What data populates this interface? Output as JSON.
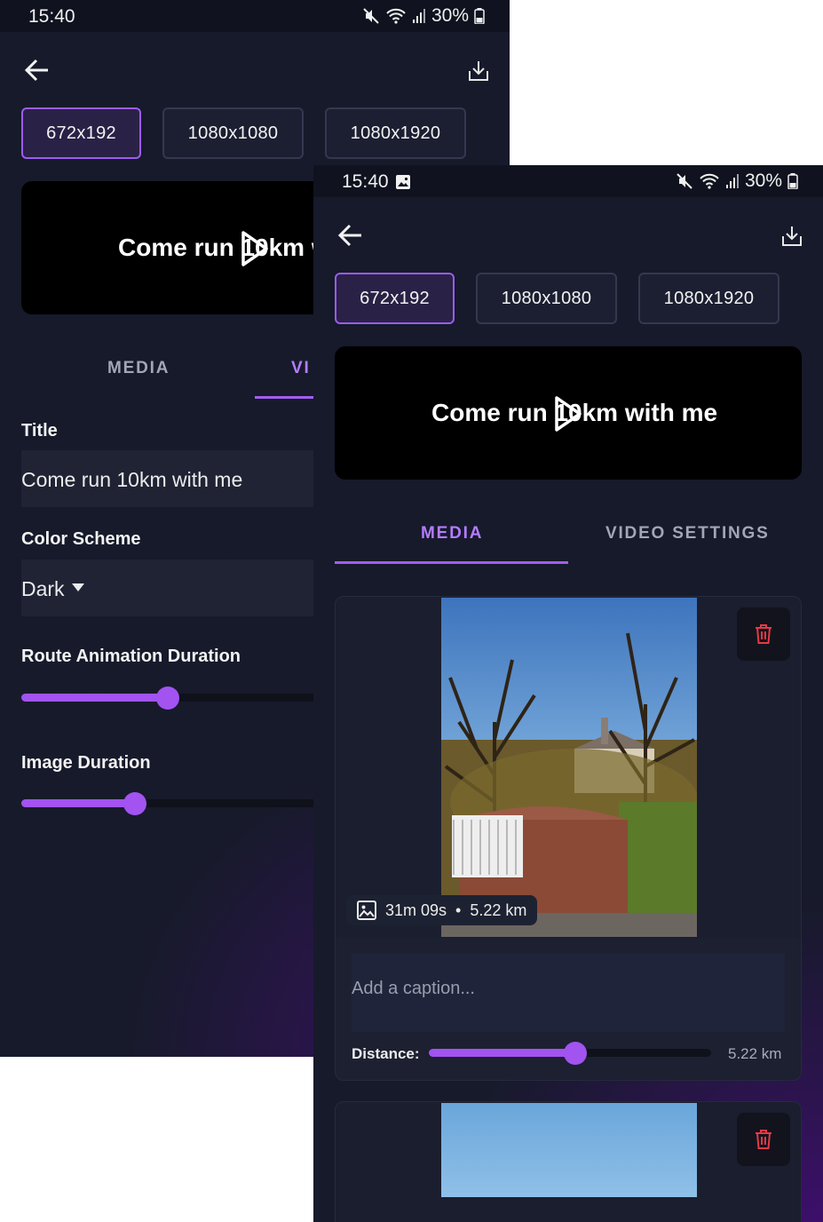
{
  "status_bar": {
    "time": "15:40",
    "battery": "30%"
  },
  "size_options": [
    "672x192",
    "1080x1080",
    "1080x1920"
  ],
  "selected_size": "672x192",
  "preview": {
    "text": "Come run 10km with me"
  },
  "tabs": [
    {
      "label": "MEDIA"
    },
    {
      "label": "VIDEO SETTINGS"
    }
  ],
  "back_screen": {
    "active_tab": "VIDEO SETTINGS",
    "tab_labels": [
      "MEDIA",
      "VI"
    ],
    "title_label": "Title",
    "title_value": "Come run 10km with me",
    "color_scheme_label": "Color Scheme",
    "color_scheme_value": "Dark",
    "route_animation_label": "Route Animation Duration",
    "route_animation_fraction": 0.33,
    "image_duration_label": "Image Duration",
    "image_duration_fraction": 0.26
  },
  "front_screen": {
    "active_tab": "MEDIA",
    "media_items": [
      {
        "duration": "31m 09s",
        "separator": "•",
        "distance": "5.22 km",
        "caption_placeholder": "Add a caption...",
        "distance_label": "Distance:",
        "distance_value": "5.22 km",
        "distance_fraction": 0.52
      }
    ]
  },
  "colors": {
    "accent": "#a253f0",
    "background": "#161a2a",
    "delete_red": "#e53946"
  },
  "icons": {
    "back": "arrow-left-icon",
    "download": "download-icon",
    "play": "play-icon",
    "delete": "trash-icon",
    "image": "image-icon",
    "dropdown": "caret-down-icon",
    "mute": "mute-icon",
    "wifi": "wifi-icon",
    "signal": "signal-icon",
    "battery": "battery-icon",
    "gallery_notification": "gallery-icon"
  }
}
